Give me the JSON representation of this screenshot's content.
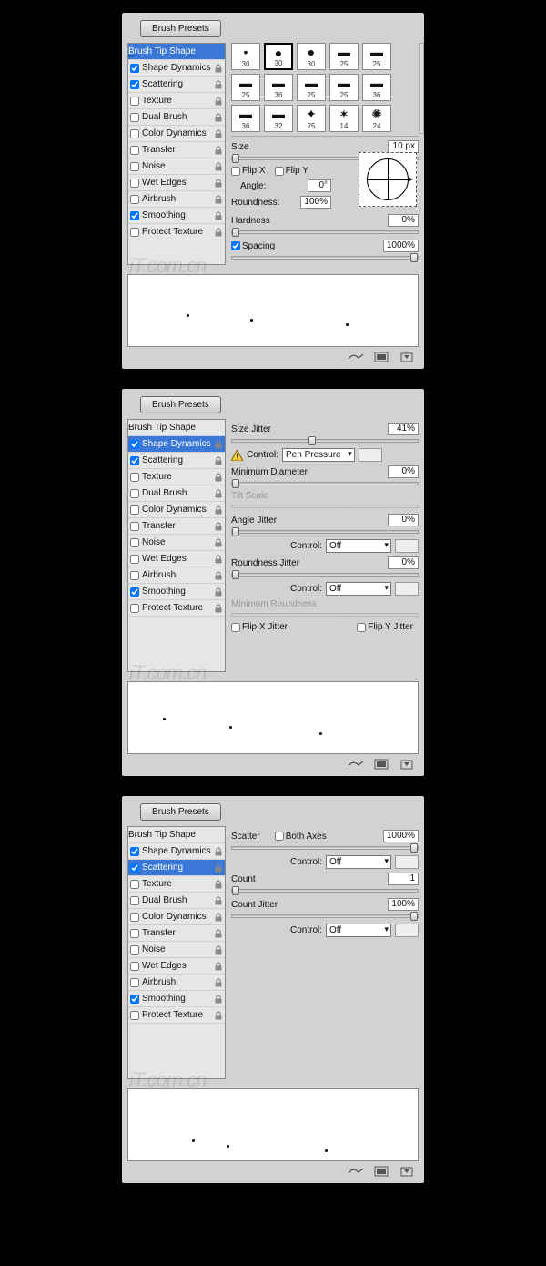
{
  "watermark": "iT.com.cn",
  "labels": {
    "brush_presets": "Brush Presets",
    "brush_tip_shape": "Brush Tip Shape"
  },
  "sidebar_items": [
    {
      "label": "Shape Dynamics",
      "checked": true,
      "lock": true
    },
    {
      "label": "Scattering",
      "checked": true,
      "lock": true
    },
    {
      "label": "Texture",
      "checked": false,
      "lock": true
    },
    {
      "label": "Dual Brush",
      "checked": false,
      "lock": true
    },
    {
      "label": "Color Dynamics",
      "checked": false,
      "lock": true
    },
    {
      "label": "Transfer",
      "checked": false,
      "lock": true
    },
    {
      "label": "Noise",
      "checked": false,
      "lock": true
    },
    {
      "label": "Wet Edges",
      "checked": false,
      "lock": true
    },
    {
      "label": "Airbrush",
      "checked": false,
      "lock": true
    },
    {
      "label": "Smoothing",
      "checked": true,
      "lock": true
    },
    {
      "label": "Protect Texture",
      "checked": false,
      "lock": true
    }
  ],
  "panel_tip": {
    "thumbs": [
      {
        "g": "•",
        "n": "30"
      },
      {
        "g": "●",
        "n": "30"
      },
      {
        "g": "●",
        "n": "30"
      },
      {
        "g": "▬",
        "n": "25"
      },
      {
        "g": "▬",
        "n": "25"
      },
      {
        "g": "▬",
        "n": "25"
      },
      {
        "g": "▬",
        "n": "36"
      },
      {
        "g": "▬",
        "n": "25"
      },
      {
        "g": "▬",
        "n": "25"
      },
      {
        "g": "▬",
        "n": "36"
      },
      {
        "g": "▬",
        "n": "36"
      },
      {
        "g": "▬",
        "n": "32"
      },
      {
        "g": "✦",
        "n": "25"
      },
      {
        "g": "✶",
        "n": "14"
      },
      {
        "g": "✺",
        "n": "24"
      }
    ],
    "size_label": "Size",
    "size_value": "10 px",
    "flipx": "Flip X",
    "flipy": "Flip Y",
    "angle_label": "Angle:",
    "angle_value": "0°",
    "roundness_label": "Roundness:",
    "roundness_value": "100%",
    "hardness_label": "Hardness",
    "hardness_value": "0%",
    "spacing_label": "Spacing",
    "spacing_value": "1000%"
  },
  "panel_dyn": {
    "size_jitter_label": "Size Jitter",
    "size_jitter_value": "41%",
    "control_label": "Control:",
    "control1": "Pen Pressure",
    "min_diam_label": "Minimum Diameter",
    "min_diam_value": "0%",
    "tilt_scale_label": "Tilt Scale",
    "angle_jitter_label": "Angle Jitter",
    "angle_jitter_value": "0%",
    "control2": "Off",
    "round_jitter_label": "Roundness Jitter",
    "round_jitter_value": "0%",
    "control3": "Off",
    "min_round_label": "Minimum Roundness",
    "flipx_jitter": "Flip X Jitter",
    "flipy_jitter": "Flip Y Jitter"
  },
  "panel_scat": {
    "scatter_label": "Scatter",
    "both_axes": "Both Axes",
    "scatter_value": "1000%",
    "control1": "Off",
    "count_label": "Count",
    "count_value": "1",
    "count_jitter_label": "Count Jitter",
    "count_jitter_value": "100%",
    "control2": "Off",
    "control_label": "Control:"
  }
}
